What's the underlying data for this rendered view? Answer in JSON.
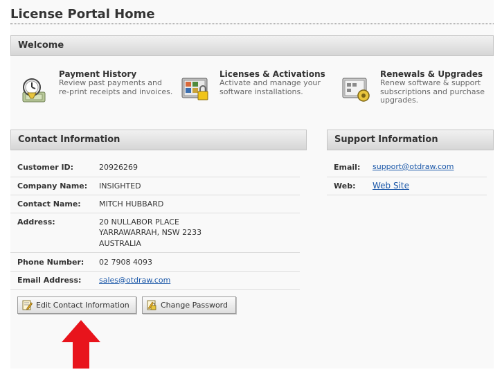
{
  "page": {
    "title": "License Portal Home"
  },
  "welcome": {
    "title": "Welcome",
    "features": [
      {
        "icon": "payment-history-icon",
        "title": "Payment History",
        "desc": "Review past payments and re-print receipts and invoices."
      },
      {
        "icon": "licenses-activations-icon",
        "title": "Licenses & Activations",
        "desc": "Activate and manage your software installations."
      },
      {
        "icon": "renewals-upgrades-icon",
        "title": "Renewals & Upgrades",
        "desc": "Renew software & support subscriptions and purchase upgrades."
      }
    ]
  },
  "contact": {
    "title": "Contact Information",
    "rows": {
      "customer_id": {
        "label": "Customer ID:",
        "value": "20926269"
      },
      "company": {
        "label": "Company Name:",
        "value": "INSIGHTED"
      },
      "name": {
        "label": "Contact Name:",
        "value": "MITCH HUBBARD"
      },
      "address": {
        "label": "Address:",
        "line1": "20 NULLABOR PLACE",
        "line2": "YARRAWARRAH, NSW 2233",
        "line3": "AUSTRALIA"
      },
      "phone": {
        "label": "Phone Number:",
        "value": "02 7908 4093"
      },
      "email": {
        "label": "Email Address:",
        "value": "sales@otdraw.com"
      }
    },
    "buttons": {
      "edit": "Edit Contact Information",
      "password": "Change Password"
    }
  },
  "support": {
    "title": "Support Information",
    "rows": {
      "email": {
        "label": "Email:",
        "value": "support@otdraw.com"
      },
      "web": {
        "label": "Web:",
        "value": "Web Site"
      }
    }
  },
  "colors": {
    "arrow": "#e8141c",
    "link": "#1a57a8",
    "header_top": "#f1f1f1",
    "header_bottom": "#d6d6d6"
  }
}
